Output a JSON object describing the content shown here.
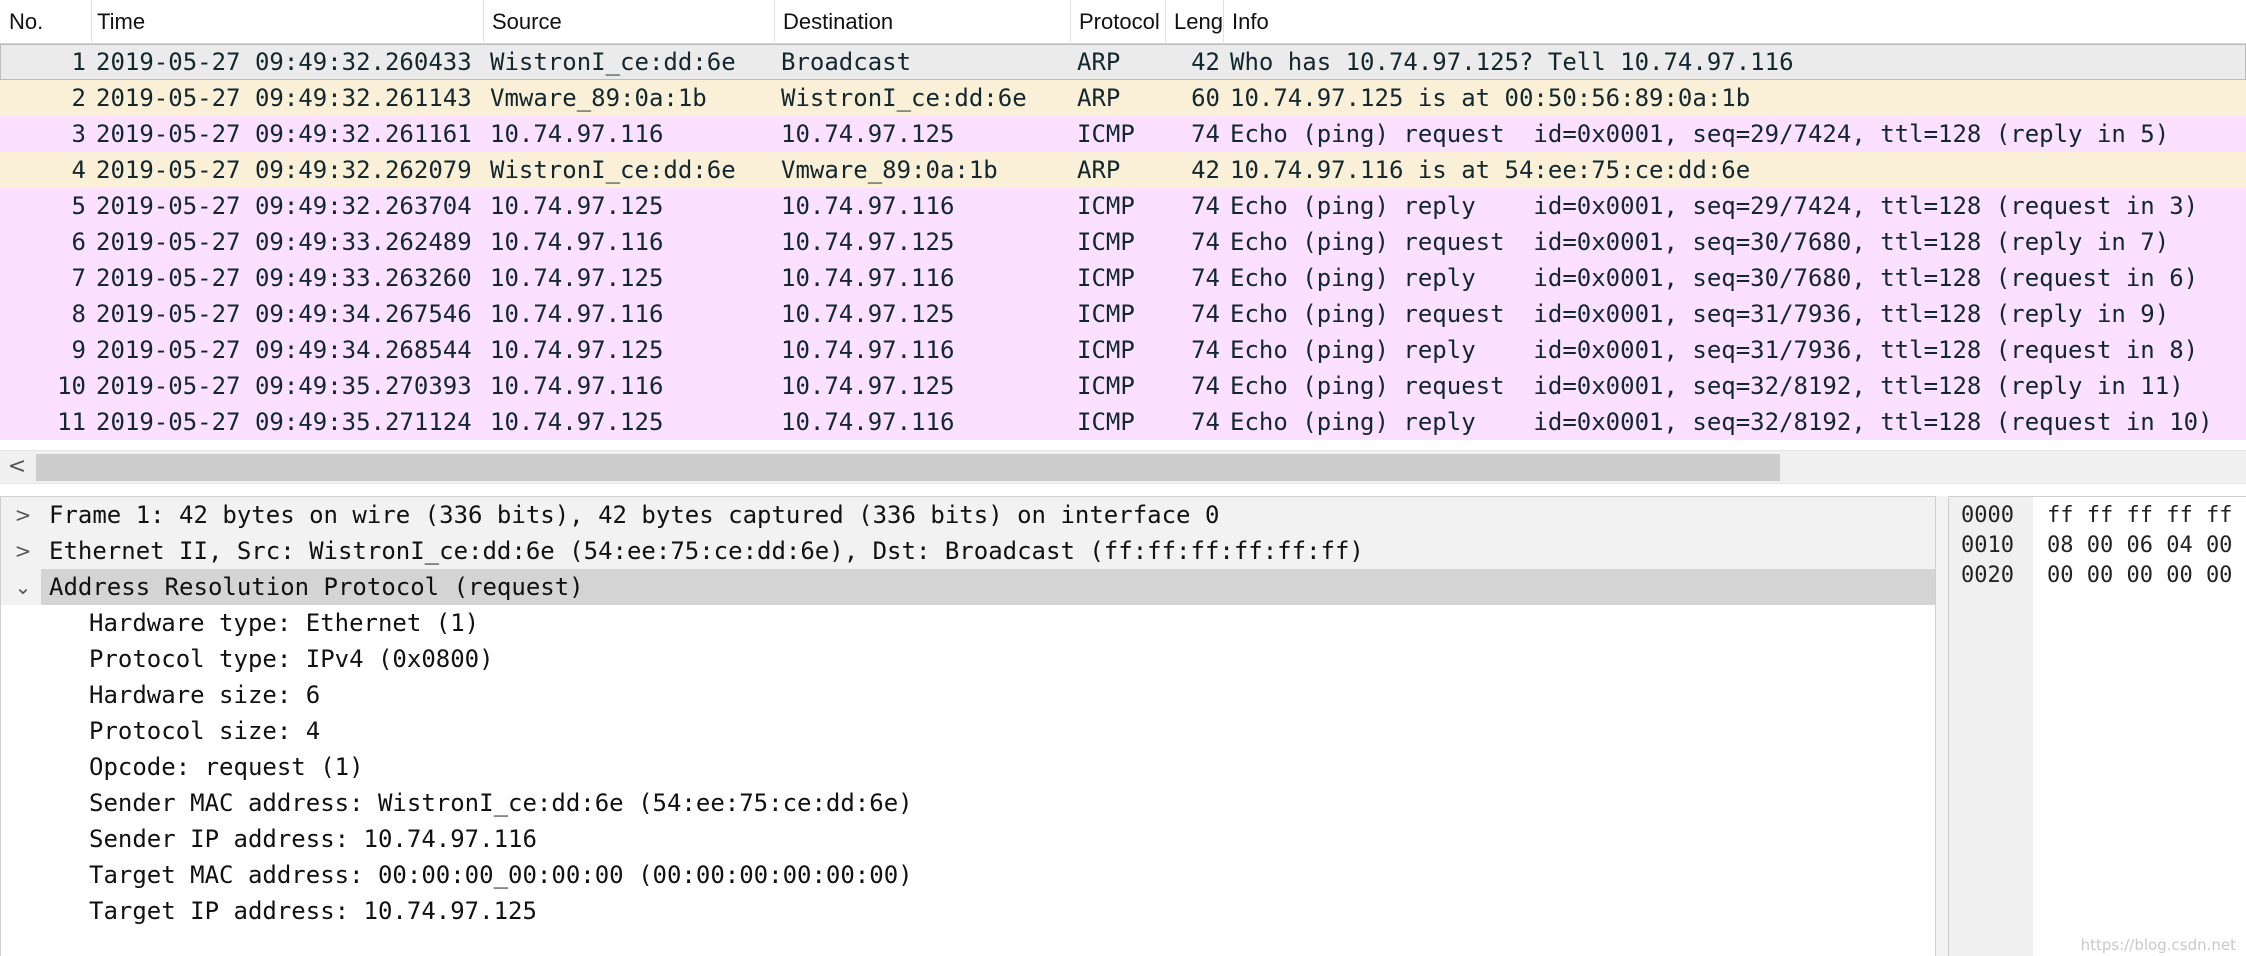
{
  "columns": {
    "no": "No.",
    "time": "Time",
    "source": "Source",
    "destination": "Destination",
    "protocol": "Protocol",
    "length": "Leng",
    "info": "Info"
  },
  "packets": [
    {
      "no": "1",
      "time": "2019-05-27 09:49:32.260433",
      "source": "WistronI_ce:dd:6e",
      "destination": "Broadcast",
      "protocol": "ARP",
      "length": "42",
      "info": "Who has 10.74.97.125? Tell 10.74.97.116"
    },
    {
      "no": "2",
      "time": "2019-05-27 09:49:32.261143",
      "source": "Vmware_89:0a:1b",
      "destination": "WistronI_ce:dd:6e",
      "protocol": "ARP",
      "length": "60",
      "info": "10.74.97.125 is at 00:50:56:89:0a:1b"
    },
    {
      "no": "3",
      "time": "2019-05-27 09:49:32.261161",
      "source": "10.74.97.116",
      "destination": "10.74.97.125",
      "protocol": "ICMP",
      "length": "74",
      "info": "Echo (ping) request  id=0x0001, seq=29/7424, ttl=128 (reply in 5)"
    },
    {
      "no": "4",
      "time": "2019-05-27 09:49:32.262079",
      "source": "WistronI_ce:dd:6e",
      "destination": "Vmware_89:0a:1b",
      "protocol": "ARP",
      "length": "42",
      "info": "10.74.97.116 is at 54:ee:75:ce:dd:6e"
    },
    {
      "no": "5",
      "time": "2019-05-27 09:49:32.263704",
      "source": "10.74.97.125",
      "destination": "10.74.97.116",
      "protocol": "ICMP",
      "length": "74",
      "info": "Echo (ping) reply    id=0x0001, seq=29/7424, ttl=128 (request in 3)"
    },
    {
      "no": "6",
      "time": "2019-05-27 09:49:33.262489",
      "source": "10.74.97.116",
      "destination": "10.74.97.125",
      "protocol": "ICMP",
      "length": "74",
      "info": "Echo (ping) request  id=0x0001, seq=30/7680, ttl=128 (reply in 7)"
    },
    {
      "no": "7",
      "time": "2019-05-27 09:49:33.263260",
      "source": "10.74.97.125",
      "destination": "10.74.97.116",
      "protocol": "ICMP",
      "length": "74",
      "info": "Echo (ping) reply    id=0x0001, seq=30/7680, ttl=128 (request in 6)"
    },
    {
      "no": "8",
      "time": "2019-05-27 09:49:34.267546",
      "source": "10.74.97.116",
      "destination": "10.74.97.125",
      "protocol": "ICMP",
      "length": "74",
      "info": "Echo (ping) request  id=0x0001, seq=31/7936, ttl=128 (reply in 9)"
    },
    {
      "no": "9",
      "time": "2019-05-27 09:49:34.268544",
      "source": "10.74.97.125",
      "destination": "10.74.97.116",
      "protocol": "ICMP",
      "length": "74",
      "info": "Echo (ping) reply    id=0x0001, seq=31/7936, ttl=128 (request in 8)"
    },
    {
      "no": "10",
      "time": "2019-05-27 09:49:35.270393",
      "source": "10.74.97.116",
      "destination": "10.74.97.125",
      "protocol": "ICMP",
      "length": "74",
      "info": "Echo (ping) request  id=0x0001, seq=32/8192, ttl=128 (reply in 11)"
    },
    {
      "no": "11",
      "time": "2019-05-27 09:49:35.271124",
      "source": "10.74.97.125",
      "destination": "10.74.97.116",
      "protocol": "ICMP",
      "length": "74",
      "info": "Echo (ping) reply    id=0x0001, seq=32/8192, ttl=128 (request in 10)"
    }
  ],
  "scrollbar": {
    "left_arrow": "<"
  },
  "details": {
    "frame": "Frame 1: 42 bytes on wire (336 bits), 42 bytes captured (336 bits) on interface 0",
    "ethernet": "Ethernet II, Src: WistronI_ce:dd:6e (54:ee:75:ce:dd:6e), Dst: Broadcast (ff:ff:ff:ff:ff:ff)",
    "arp": "Address Resolution Protocol (request)",
    "arp_fields": [
      "Hardware type: Ethernet (1)",
      "Protocol type: IPv4 (0x0800)",
      "Hardware size: 6",
      "Protocol size: 4",
      "Opcode: request (1)",
      "Sender MAC address: WistronI_ce:dd:6e (54:ee:75:ce:dd:6e)",
      "Sender IP address: 10.74.97.116",
      "Target MAC address: 00:00:00_00:00:00 (00:00:00:00:00:00)",
      "Target IP address: 10.74.97.125"
    ],
    "collapsed_glyph": ">",
    "expanded_glyph": "⌄"
  },
  "bytes": [
    {
      "offset": "0000",
      "hex": "ff ff ff ff ff"
    },
    {
      "offset": "0010",
      "hex": "08 00 06 04 00"
    },
    {
      "offset": "0020",
      "hex": "00 00 00 00 00"
    }
  ],
  "watermark": "https://blog.csdn.net",
  "colors": {
    "selected_row": "#ebebeb",
    "arp_row": "#faf0d7",
    "icmp_row": "#fce0ff",
    "expanded_node": "#d4d4d4"
  }
}
